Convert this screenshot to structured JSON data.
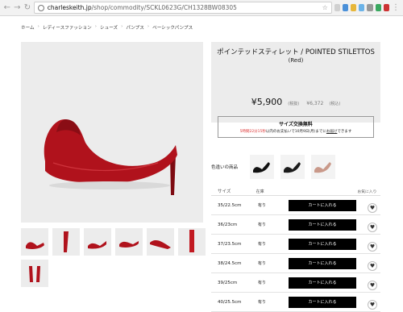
{
  "browser": {
    "url_domain": "charleskeith.jp",
    "url_path": "/shop/commodity/SCKL0623G/CH1328BW08305"
  },
  "breadcrumb": [
    "ホーム",
    "レディースファッション",
    "シューズ",
    "パンプス",
    "ベーシックパンプス"
  ],
  "product": {
    "title": "ポインテッドスティレット / POINTED STILETTOS",
    "color": "(Red)",
    "price": "¥5,900",
    "price_tax_label": "(税抜)",
    "price_with_tax": "¥6,372",
    "price_with_tax_label": "(税込)"
  },
  "exchange": {
    "title": "サイズ交換無料",
    "text_highlight": "5時間22分15秒",
    "text_middle": "以内のお支払いで10月9日(月)までに",
    "text_link": "お届け",
    "text_end": "できます"
  },
  "colors": {
    "label": "色違いの商品",
    "swatches": [
      {
        "name": "black-patent",
        "color": "#111111"
      },
      {
        "name": "black",
        "color": "#1b1b1b"
      },
      {
        "name": "nude",
        "color": "#c9998a"
      }
    ]
  },
  "sizes": {
    "headers": [
      "サイズ",
      "在庫",
      "",
      "お気に入り"
    ],
    "cart_label": "カートに入れる",
    "rows": [
      {
        "size": "35/22.5cm",
        "stock": "有り"
      },
      {
        "size": "36/23cm",
        "stock": "有り"
      },
      {
        "size": "37/23.5cm",
        "stock": "有り"
      },
      {
        "size": "38/24.5cm",
        "stock": "有り"
      },
      {
        "size": "39/25cm",
        "stock": "有り"
      },
      {
        "size": "40/25.5cm",
        "stock": "有り"
      }
    ]
  },
  "accent": {
    "shoe_red": "#b0121c",
    "cart_black": "#000000"
  }
}
